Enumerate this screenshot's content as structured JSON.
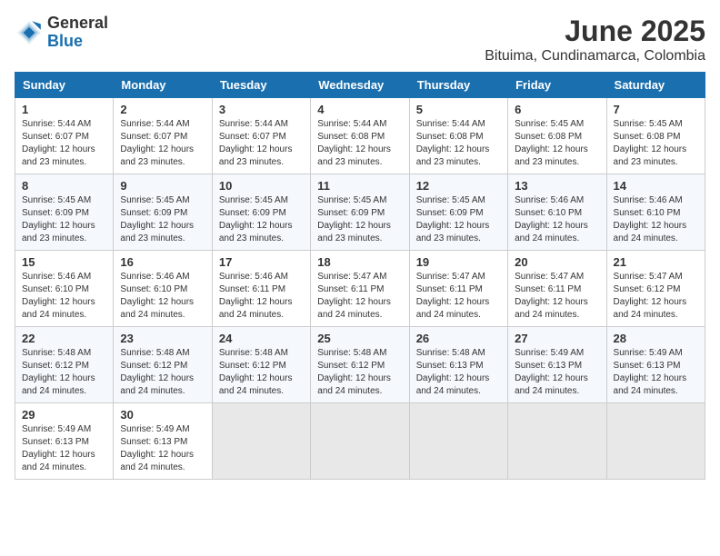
{
  "logo": {
    "general": "General",
    "blue": "Blue"
  },
  "header": {
    "month": "June 2025",
    "location": "Bituima, Cundinamarca, Colombia"
  },
  "weekdays": [
    "Sunday",
    "Monday",
    "Tuesday",
    "Wednesday",
    "Thursday",
    "Friday",
    "Saturday"
  ],
  "weeks": [
    [
      {
        "day": "1",
        "sunrise": "5:44 AM",
        "sunset": "6:07 PM",
        "daylight": "12 hours and 23 minutes."
      },
      {
        "day": "2",
        "sunrise": "5:44 AM",
        "sunset": "6:07 PM",
        "daylight": "12 hours and 23 minutes."
      },
      {
        "day": "3",
        "sunrise": "5:44 AM",
        "sunset": "6:07 PM",
        "daylight": "12 hours and 23 minutes."
      },
      {
        "day": "4",
        "sunrise": "5:44 AM",
        "sunset": "6:08 PM",
        "daylight": "12 hours and 23 minutes."
      },
      {
        "day": "5",
        "sunrise": "5:44 AM",
        "sunset": "6:08 PM",
        "daylight": "12 hours and 23 minutes."
      },
      {
        "day": "6",
        "sunrise": "5:45 AM",
        "sunset": "6:08 PM",
        "daylight": "12 hours and 23 minutes."
      },
      {
        "day": "7",
        "sunrise": "5:45 AM",
        "sunset": "6:08 PM",
        "daylight": "12 hours and 23 minutes."
      }
    ],
    [
      {
        "day": "8",
        "sunrise": "5:45 AM",
        "sunset": "6:09 PM",
        "daylight": "12 hours and 23 minutes."
      },
      {
        "day": "9",
        "sunrise": "5:45 AM",
        "sunset": "6:09 PM",
        "daylight": "12 hours and 23 minutes."
      },
      {
        "day": "10",
        "sunrise": "5:45 AM",
        "sunset": "6:09 PM",
        "daylight": "12 hours and 23 minutes."
      },
      {
        "day": "11",
        "sunrise": "5:45 AM",
        "sunset": "6:09 PM",
        "daylight": "12 hours and 23 minutes."
      },
      {
        "day": "12",
        "sunrise": "5:45 AM",
        "sunset": "6:09 PM",
        "daylight": "12 hours and 23 minutes."
      },
      {
        "day": "13",
        "sunrise": "5:46 AM",
        "sunset": "6:10 PM",
        "daylight": "12 hours and 24 minutes."
      },
      {
        "day": "14",
        "sunrise": "5:46 AM",
        "sunset": "6:10 PM",
        "daylight": "12 hours and 24 minutes."
      }
    ],
    [
      {
        "day": "15",
        "sunrise": "5:46 AM",
        "sunset": "6:10 PM",
        "daylight": "12 hours and 24 minutes."
      },
      {
        "day": "16",
        "sunrise": "5:46 AM",
        "sunset": "6:10 PM",
        "daylight": "12 hours and 24 minutes."
      },
      {
        "day": "17",
        "sunrise": "5:46 AM",
        "sunset": "6:11 PM",
        "daylight": "12 hours and 24 minutes."
      },
      {
        "day": "18",
        "sunrise": "5:47 AM",
        "sunset": "6:11 PM",
        "daylight": "12 hours and 24 minutes."
      },
      {
        "day": "19",
        "sunrise": "5:47 AM",
        "sunset": "6:11 PM",
        "daylight": "12 hours and 24 minutes."
      },
      {
        "day": "20",
        "sunrise": "5:47 AM",
        "sunset": "6:11 PM",
        "daylight": "12 hours and 24 minutes."
      },
      {
        "day": "21",
        "sunrise": "5:47 AM",
        "sunset": "6:12 PM",
        "daylight": "12 hours and 24 minutes."
      }
    ],
    [
      {
        "day": "22",
        "sunrise": "5:48 AM",
        "sunset": "6:12 PM",
        "daylight": "12 hours and 24 minutes."
      },
      {
        "day": "23",
        "sunrise": "5:48 AM",
        "sunset": "6:12 PM",
        "daylight": "12 hours and 24 minutes."
      },
      {
        "day": "24",
        "sunrise": "5:48 AM",
        "sunset": "6:12 PM",
        "daylight": "12 hours and 24 minutes."
      },
      {
        "day": "25",
        "sunrise": "5:48 AM",
        "sunset": "6:12 PM",
        "daylight": "12 hours and 24 minutes."
      },
      {
        "day": "26",
        "sunrise": "5:48 AM",
        "sunset": "6:13 PM",
        "daylight": "12 hours and 24 minutes."
      },
      {
        "day": "27",
        "sunrise": "5:49 AM",
        "sunset": "6:13 PM",
        "daylight": "12 hours and 24 minutes."
      },
      {
        "day": "28",
        "sunrise": "5:49 AM",
        "sunset": "6:13 PM",
        "daylight": "12 hours and 24 minutes."
      }
    ],
    [
      {
        "day": "29",
        "sunrise": "5:49 AM",
        "sunset": "6:13 PM",
        "daylight": "12 hours and 24 minutes."
      },
      {
        "day": "30",
        "sunrise": "5:49 AM",
        "sunset": "6:13 PM",
        "daylight": "12 hours and 24 minutes."
      },
      null,
      null,
      null,
      null,
      null
    ]
  ],
  "labels": {
    "sunrise": "Sunrise:",
    "sunset": "Sunset:",
    "daylight": "Daylight:"
  }
}
